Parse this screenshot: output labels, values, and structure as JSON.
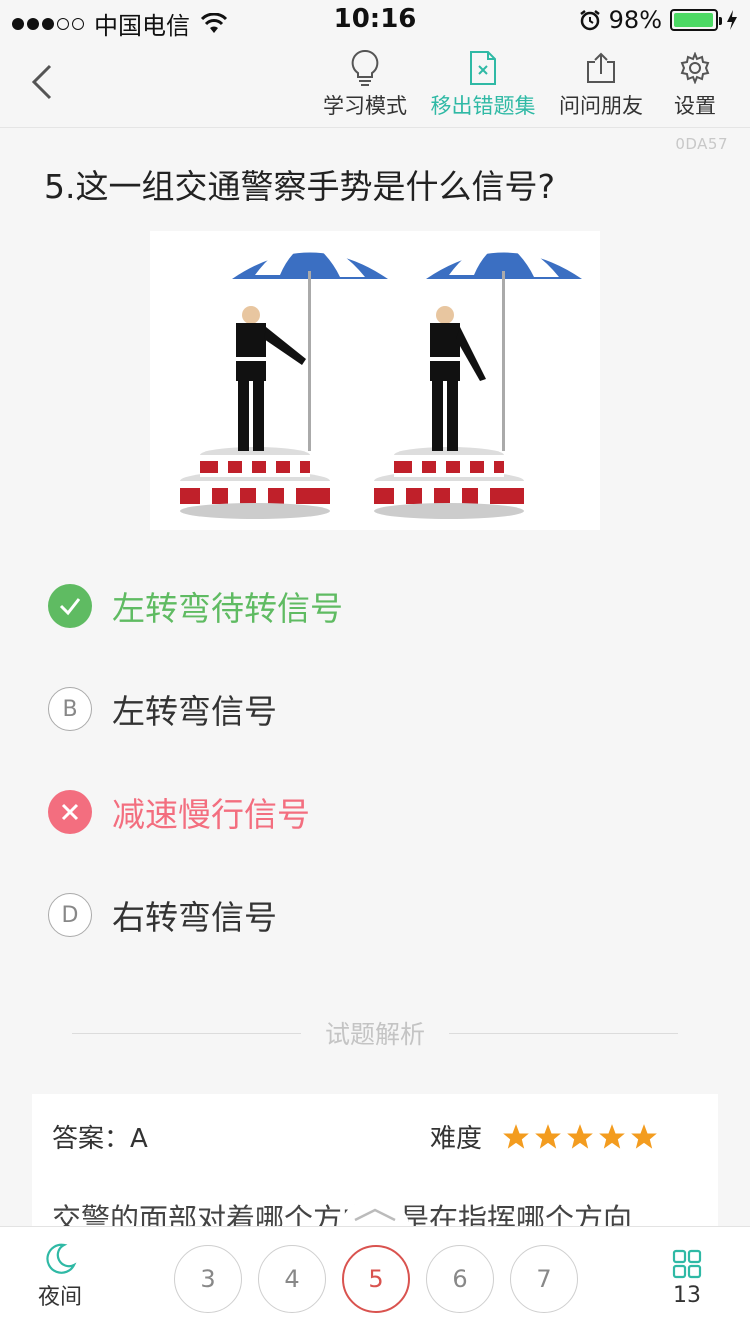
{
  "status_bar": {
    "carrier": "中国电信",
    "time": "10:16",
    "battery_percent": "98%",
    "battery_level": 0.98
  },
  "nav": {
    "back_icon": "chevron-left-icon",
    "actions": [
      {
        "label": "学习模式",
        "icon": "lightbulb-icon"
      },
      {
        "label": "移出错题集",
        "icon": "remove-file-icon",
        "active": true
      },
      {
        "label": "问问朋友",
        "icon": "share-icon"
      },
      {
        "label": "设置",
        "icon": "gear-icon"
      }
    ],
    "accent_color": "#2fb9a5"
  },
  "question": {
    "id_code": "0DA57",
    "text": "5.这一组交通警察手势是什么信号?"
  },
  "options": [
    {
      "mark": "",
      "text": "左转弯待转信号",
      "state": "correct"
    },
    {
      "mark": "B",
      "text": "左转弯信号",
      "state": "normal"
    },
    {
      "mark": "",
      "text": "减速慢行信号",
      "state": "wrong"
    },
    {
      "mark": "D",
      "text": "右转弯信号",
      "state": "normal"
    }
  ],
  "colors": {
    "correct": "#5fbb62",
    "wrong": "#f36e7f",
    "star": "#f39c1f",
    "current_page": "#d9534f"
  },
  "analysis": {
    "section_title": "试题解析",
    "answer_label": "答案：A",
    "difficulty_label": "难度",
    "difficulty_stars": 5,
    "explanation": "交警的面部对着哪个方向就是在指挥哪个方向"
  },
  "bottom": {
    "night_label": "夜间",
    "pages": [
      "3",
      "4",
      "5",
      "6",
      "7"
    ],
    "current_page": "5",
    "total_count": "13"
  }
}
